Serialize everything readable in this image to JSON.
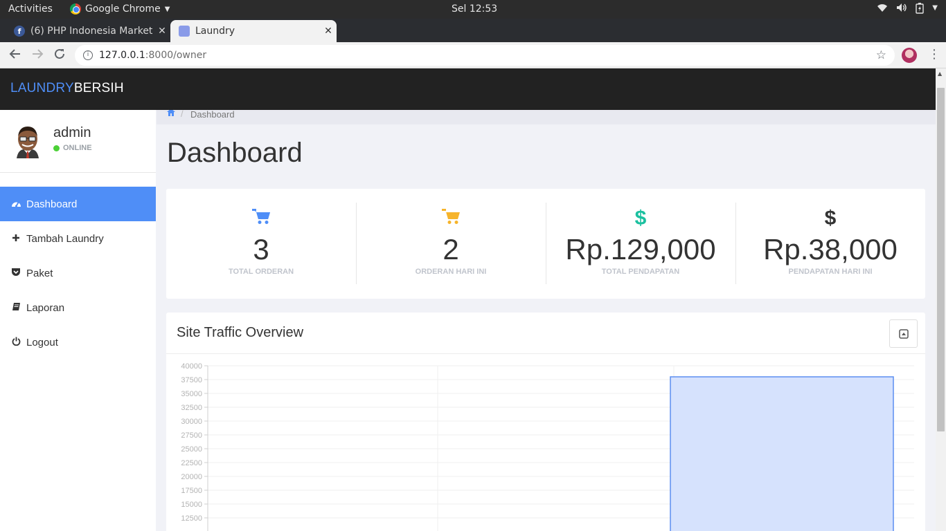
{
  "os": {
    "activities": "Activities",
    "app_name": "Google Chrome",
    "clock": "Sel 12:53"
  },
  "browser": {
    "tabs": [
      {
        "title": "(6) PHP Indonesia Market",
        "favicon": "facebook-icon",
        "active": false
      },
      {
        "title": "Laundry",
        "favicon": "page-icon",
        "active": true
      }
    ],
    "url_host": "127.0.0.1",
    "url_rest": ":8000/owner"
  },
  "app": {
    "brand_primary": "LAUNDRY",
    "brand_secondary": "BERSIH",
    "brand_colors": {
      "primary": "#4f8ef7",
      "secondary": "#ffffff"
    }
  },
  "user": {
    "name": "admin",
    "status": "ONLINE"
  },
  "sidebar": {
    "items": [
      {
        "label": "Dashboard",
        "icon": "dashboard-icon",
        "active": true
      },
      {
        "label": "Tambah Laundry",
        "icon": "plus-icon",
        "active": false
      },
      {
        "label": "Paket",
        "icon": "pocket-icon",
        "active": false
      },
      {
        "label": "Laporan",
        "icon": "book-icon",
        "active": false
      },
      {
        "label": "Logout",
        "icon": "power-icon",
        "active": false
      }
    ]
  },
  "breadcrumb": {
    "home_icon": "home-icon",
    "current": "Dashboard"
  },
  "page": {
    "title": "Dashboard"
  },
  "stats": [
    {
      "value": "3",
      "label": "TOTAL ORDERAN",
      "icon": "cart-icon",
      "color": "#4f8ef7"
    },
    {
      "value": "2",
      "label": "ORDERAN HARI INI",
      "icon": "cart-icon",
      "color": "#f6b42b"
    },
    {
      "value": "Rp.129,000",
      "label": "TOTAL PENDAPATAN",
      "icon": "dollar-icon",
      "color": "#1cc0a0"
    },
    {
      "value": "Rp.38,000",
      "label": "PENDAPATAN HARI INI",
      "icon": "dollar-icon",
      "color": "#333333"
    }
  ],
  "panel": {
    "title": "Site Traffic Overview",
    "collapse_icon": "collapse-icon"
  },
  "chart_data": {
    "type": "bar",
    "categories": [
      "",
      "",
      ""
    ],
    "values": [
      0,
      0,
      38000
    ],
    "yticks": [
      "40000",
      "37500",
      "35000",
      "32500",
      "30000",
      "27500",
      "25000",
      "22500",
      "20000",
      "17500",
      "15000",
      "12500"
    ],
    "ylim": [
      0,
      40000
    ],
    "grid": true,
    "bar_fill": "#d6e2fd",
    "bar_stroke": "#5b8ef0"
  }
}
